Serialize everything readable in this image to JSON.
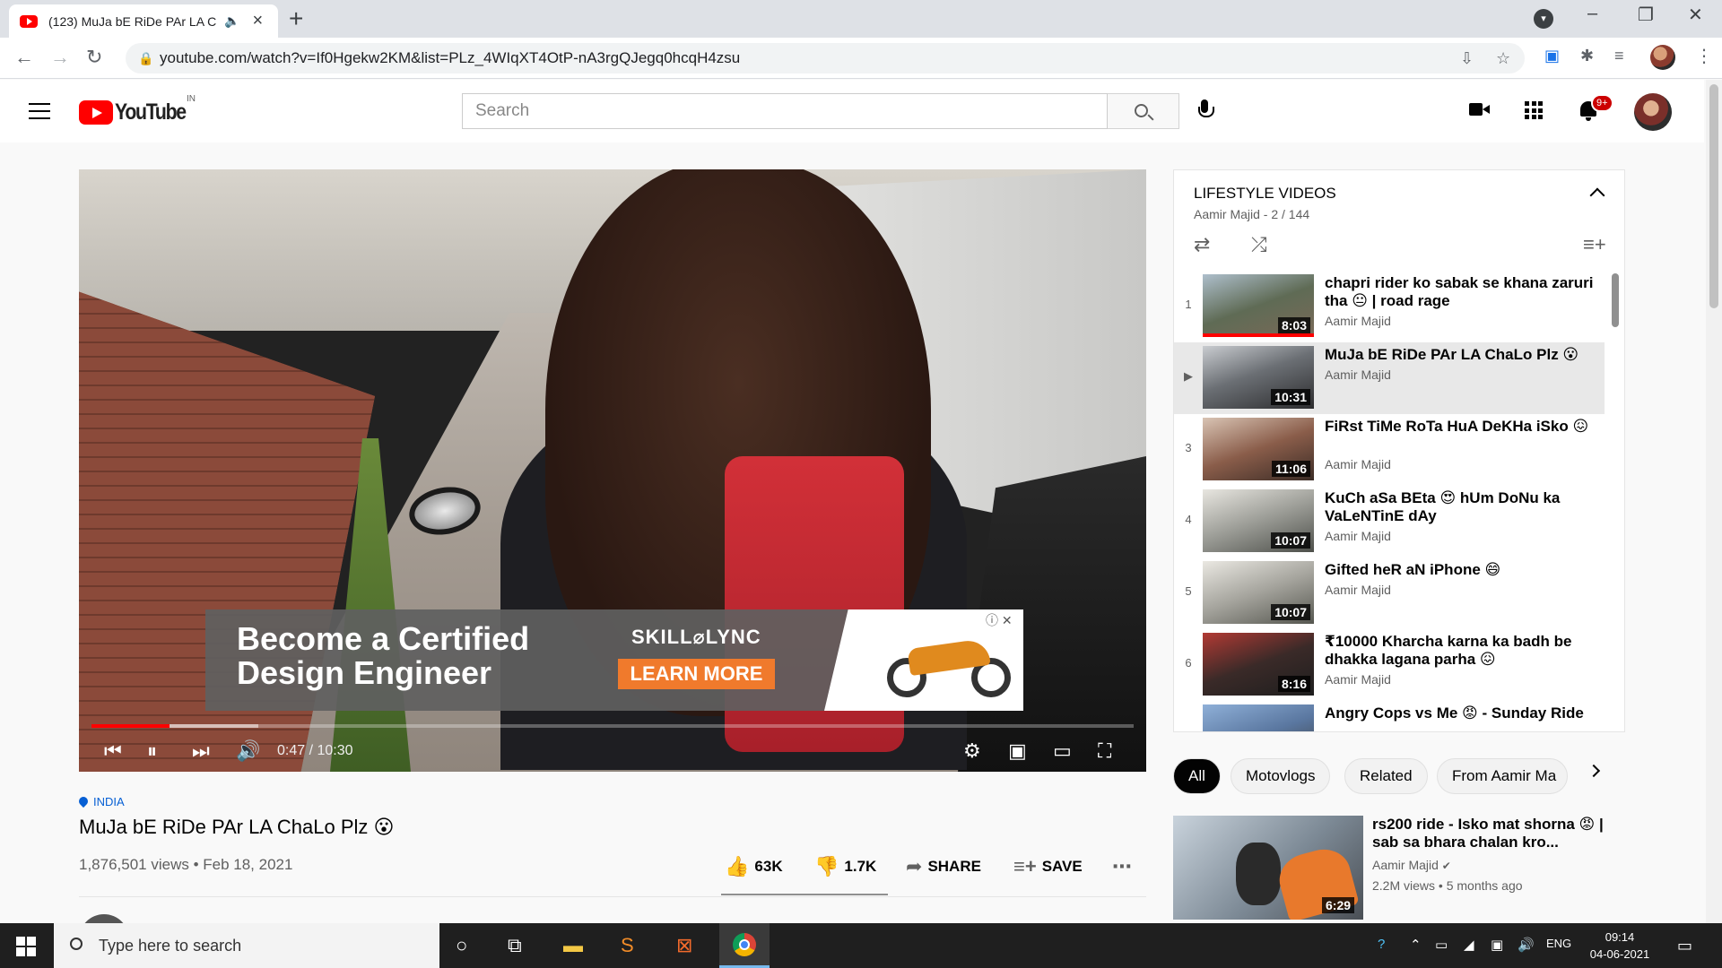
{
  "browser": {
    "tab_title": "(123) MuJa bE RiDe PAr LA C",
    "url": "youtube.com/watch?v=If0Hgekw2KM&list=PLz_4WIqXT4OtP-nA3rgQJegq0hcqH4zsu"
  },
  "header": {
    "logo_text": "YouTube",
    "country_code": "IN",
    "search_placeholder": "Search",
    "notification_count": "9+"
  },
  "player": {
    "current_time": "0:47",
    "duration": "10:30",
    "time_display": "0:47 / 10:30",
    "played_fraction": 0.075,
    "ad": {
      "headline_line1": "Become a Certified",
      "headline_line2": "Design Engineer",
      "brand": "SKILL⌀LYNC",
      "cta": "LEARN MORE"
    }
  },
  "video": {
    "location": "INDIA",
    "title": "MuJa bE RiDe PAr LA ChaLo Plz 😮",
    "meta": "1,876,501 views • Feb 18, 2021",
    "likes": "63K",
    "dislikes": "1.7K",
    "share_label": "SHARE",
    "save_label": "SAVE"
  },
  "playlist": {
    "title": "LIFESTYLE VIDEOS",
    "subtitle": "Aamir Majid - 2 / 144",
    "items": [
      {
        "index": "1",
        "title": "chapri rider ko sabak se khana zaruri tha 😐 | road rage",
        "channel": "Aamir Majid",
        "duration": "8:03",
        "watched": true
      },
      {
        "index": "▶",
        "title": "MuJa bE RiDe PAr LA ChaLo Plz 😮",
        "channel": "Aamir Majid",
        "duration": "10:31",
        "active": true
      },
      {
        "index": "3",
        "title": "FiRst TiMe RoTa HuA DeKHa iSko 😖",
        "channel": "Aamir Majid",
        "duration": "11:06"
      },
      {
        "index": "4",
        "title": "KuCh aSa BEta 😍 hUm DoNu ka VaLeNTinE dAy",
        "channel": "Aamir Majid",
        "duration": "10:07"
      },
      {
        "index": "5",
        "title": "Gifted heR aN iPhone 😄",
        "channel": "Aamir Majid",
        "duration": "10:07"
      },
      {
        "index": "6",
        "title": "₹10000 Kharcha karna ka badh be dhakka lagana parha 😖",
        "channel": "Aamir Majid",
        "duration": "8:16"
      },
      {
        "index": "",
        "title": "Angry Cops vs Me 😡 - Sunday Ride",
        "channel": "",
        "duration": ""
      }
    ]
  },
  "chips": [
    "All",
    "Motovlogs",
    "Related",
    "From Aamir Ma"
  ],
  "related": {
    "title": "rs200 ride - Isko mat shorna 😡 | sab sa bhara chalan kro...",
    "channel": "Aamir Majid",
    "views": "2.2M views • 5 months ago",
    "duration": "6:29"
  },
  "taskbar": {
    "search_placeholder": "Type here to search",
    "language": "ENG",
    "time": "09:14",
    "date": "04-06-2021"
  },
  "colors": {
    "youtube_red": "#ff0000",
    "link_blue": "#065fd4",
    "ad_cta_orange": "#f07a2c"
  }
}
